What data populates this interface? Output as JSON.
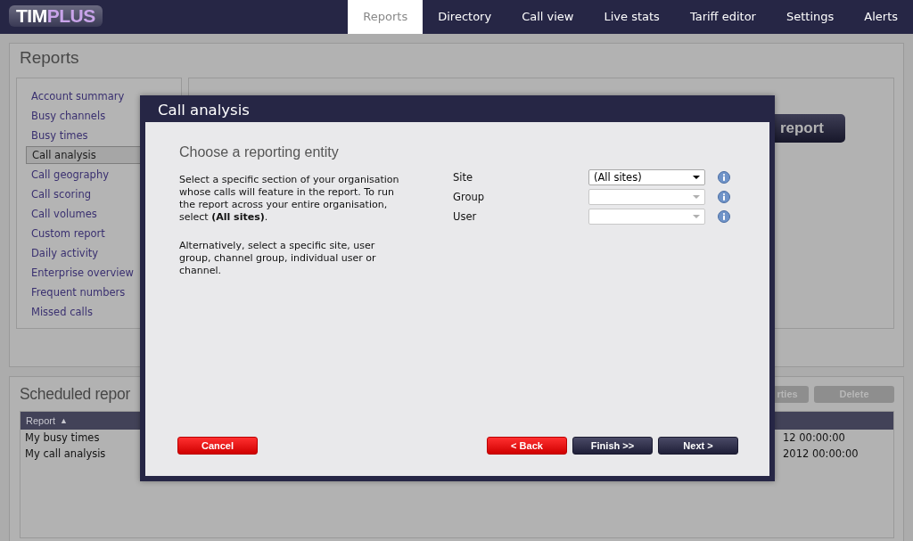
{
  "header": {
    "logo": {
      "primary": "TIM",
      "accent": "PLUS"
    },
    "nav": [
      {
        "label": "Reports",
        "selected": true
      },
      {
        "label": "Directory",
        "selected": false
      },
      {
        "label": "Call view",
        "selected": false
      },
      {
        "label": "Live stats",
        "selected": false
      },
      {
        "label": "Tariff editor",
        "selected": false
      },
      {
        "label": "Settings",
        "selected": false
      },
      {
        "label": "Alerts",
        "selected": false
      }
    ]
  },
  "reports_panel": {
    "title": "Reports",
    "sidebar": [
      {
        "label": "Account summary",
        "selected": false
      },
      {
        "label": "Busy channels",
        "selected": false
      },
      {
        "label": "Busy times",
        "selected": false
      },
      {
        "label": "Call analysis",
        "selected": true
      },
      {
        "label": "Call geography",
        "selected": false
      },
      {
        "label": "Call scoring",
        "selected": false
      },
      {
        "label": "Call volumes",
        "selected": false
      },
      {
        "label": "Custom report",
        "selected": false
      },
      {
        "label": "Daily activity",
        "selected": false
      },
      {
        "label": "Enterprise overview",
        "selected": false
      },
      {
        "label": "Frequent numbers",
        "selected": false
      },
      {
        "label": "Missed calls",
        "selected": false
      }
    ],
    "content": {
      "button": "report"
    }
  },
  "scheduled_panel": {
    "title": "Scheduled repor",
    "buttons": [
      "rties",
      "Delete"
    ],
    "table": {
      "columns": [
        {
          "label": "Report",
          "sort_indicator": "▲"
        }
      ],
      "rows": [
        {
          "report": "My busy times",
          "column_2": "12 00:00:00"
        },
        {
          "report": "My call analysis",
          "column_2": "2012 00:00:00"
        }
      ]
    }
  },
  "dialog": {
    "title": "Call analysis",
    "heading": "Choose a reporting entity",
    "paragraphs": [
      "Select a specific section of your organisation whose calls will feature in the report.  To run the report across your entire organisation, select **(All sites)**.",
      "Alternatively, select a specific site, user group, channel group, individual user or channel."
    ],
    "fields": [
      {
        "label": "Site",
        "value": "(All sites)",
        "disabled": false
      },
      {
        "label": "Group",
        "disabled": true
      },
      {
        "label": "User",
        "disabled": true
      }
    ],
    "buttons": [
      {
        "label": "Cancel",
        "kind": "danger"
      },
      {
        "label": "< Back",
        "kind": "danger"
      },
      {
        "label": "Finish >>",
        "kind": "primary"
      },
      {
        "label": "Next >",
        "kind": "primary"
      }
    ]
  }
}
